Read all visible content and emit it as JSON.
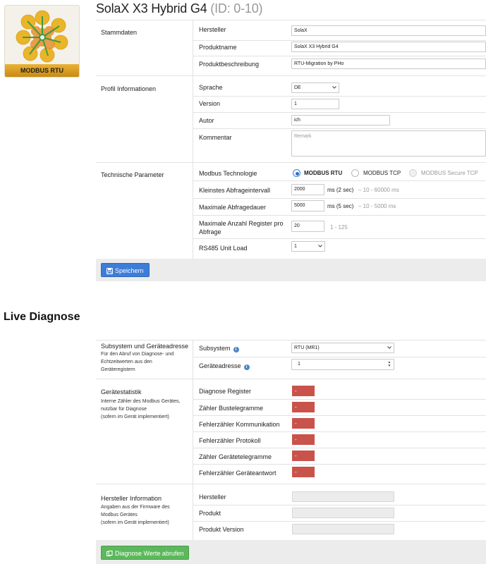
{
  "logo": {
    "label": "MODBUS RTU"
  },
  "header": {
    "name": "SolaX X3 Hybrid G4",
    "id_text": "(ID: 0-10)"
  },
  "stammdaten": {
    "title": "Stammdaten",
    "hersteller_label": "Hersteller",
    "hersteller_value": "SolaX",
    "produktname_label": "Produktname",
    "produktname_value": "SolaX X3 Hybrid G4",
    "beschreibung_label": "Produktbeschreibung",
    "beschreibung_value": "RTU-Migration by PHo"
  },
  "profil": {
    "title": "Profil Informationen",
    "sprache_label": "Sprache",
    "sprache_value": "DE",
    "version_label": "Version",
    "version_value": "1",
    "autor_label": "Autor",
    "autor_value": "ich",
    "kommentar_label": "Kommentar",
    "kommentar_placeholder": "Remark"
  },
  "technik": {
    "title": "Technische Parameter",
    "technologie_label": "Modbus Technologie",
    "options": [
      "MODBUS RTU",
      "MODBUS TCP",
      "MODBUS Secure TCP"
    ],
    "selected_option": "MODBUS RTU",
    "intervall_label": "Kleinstes Abfrageintervall",
    "intervall_value": "2000",
    "intervall_unit": "ms (2 sec)",
    "intervall_hint": "– 10 - 60000 ms",
    "dauer_label": "Maximale Abfragedauer",
    "dauer_value": "5000",
    "dauer_unit": "ms (5 sec)",
    "dauer_hint": "– 10 - 5000 ms",
    "register_label_1": "Maximale Anzahl Register pro",
    "register_label_2": "Abfrage",
    "register_value": "20",
    "register_hint": "1 - 125",
    "rs485_label": "RS485 Unit Load",
    "rs485_value": "1",
    "save_label": "Speichern"
  },
  "live": {
    "title": "Live Diagnose",
    "subsystem_group": "Subsystem und Geräteadresse",
    "subsystem_desc": [
      "Für den Abruf von Diagnose- und",
      "Echtzeitwerten aus den",
      "Geräteregistern"
    ],
    "subsystem_label": "Subsystem",
    "subsystem_value": "RTU (MR1)",
    "adresse_label": "Geräteadresse",
    "adresse_value": "1",
    "statistik_group": "Gerätestatistik",
    "statistik_desc": [
      "Interne Zähler des Modbus Gerätes,",
      "nutzbar für Diagnose",
      "(sofern im Gerät implementiert)"
    ],
    "counters": [
      {
        "label": "Diagnose Register",
        "value": "-"
      },
      {
        "label": "Zähler Bustelegramme",
        "value": "-"
      },
      {
        "label": "Fehlerzähler Kommunikation",
        "value": "-"
      },
      {
        "label": "Fehlerzähler Protokoll",
        "value": "-"
      },
      {
        "label": "Zähler Gerätetelegramme",
        "value": "-"
      },
      {
        "label": "Fehlerzähler Geräteantwort",
        "value": "-"
      }
    ],
    "info_group": "Hersteller Information",
    "info_desc": [
      "Angaben aus der Firmware des",
      "Modbus Gerätes",
      "(sofern im Gerät implementiert)"
    ],
    "hersteller_label": "Hersteller",
    "produkt_label": "Produkt",
    "produkt_version_label": "Produkt Version",
    "button_label": "Diagnose Werte abrufen"
  },
  "colors": {
    "accent_blue": "#3d7dd8",
    "danger_red": "#c9534b",
    "success_green": "#5cb85c"
  }
}
